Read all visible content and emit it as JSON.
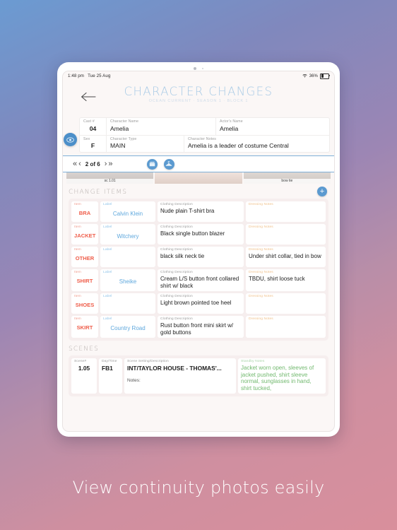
{
  "statusbar": {
    "time": "1:48 pm",
    "date": "Tue 25 Aug",
    "battery": "36%"
  },
  "header": {
    "back_icon": "back-arrow-icon",
    "title": "CHARACTER CHANGES",
    "subtitle": "OCEAN CURRENT · SEASON 1 · BLOCK 1"
  },
  "detail": {
    "eye_icon": "eye-icon",
    "cast_label": "Cast #",
    "cast_value": "04",
    "character_name_label": "Character Name",
    "character_name_value": "Amelia",
    "actor_label": "Actor's Name",
    "actor_value": "Amelia",
    "sex_label": "Sex",
    "sex_value": "F",
    "character_type_label": "Character Type",
    "character_type_value": "MAIN",
    "character_notes_label": "Character Notes",
    "character_notes_value": "Amelia is a leader of costume Central"
  },
  "pager": {
    "first": "«",
    "prev": "‹",
    "next": "›",
    "last": "»",
    "position": "2 of 6",
    "slate_icon": "clapperboard-icon",
    "hanger_icon": "clothes-hanger-icon"
  },
  "photostrip": [
    {
      "caption": "sc 1.01"
    },
    {
      "caption": ""
    },
    {
      "caption": "bow tie"
    }
  ],
  "change_items": {
    "heading": "CHANGE ITEMS",
    "add_label": "+",
    "columns": {
      "item": "Item",
      "label": "Label",
      "description": "Clothing Description",
      "notes": "Dressing Notes"
    },
    "rows": [
      {
        "item": "BRA",
        "label": "Calvin Klein",
        "description": "Nude plain T-shirt bra",
        "notes": ""
      },
      {
        "item": "JACKET",
        "label": "Witchery",
        "description": "Black single button blazer",
        "notes": ""
      },
      {
        "item": "OTHER",
        "label": "",
        "description": "black silk neck tie",
        "notes": "Under shirt collar, tied in bow"
      },
      {
        "item": "SHIRT",
        "label": "Sheike",
        "description": "Cream L/S button front collared shirt w/ black",
        "notes": "TBDU, shirt loose tuck"
      },
      {
        "item": "SHOES",
        "label": "",
        "description": "Light brown pointed toe heel",
        "notes": ""
      },
      {
        "item": "SKIRT",
        "label": "Country Road",
        "description": "Rust button front mini skirt w/ gold buttons",
        "notes": ""
      }
    ]
  },
  "scenes": {
    "heading": "SCENES",
    "columns": {
      "scene": "Scene#",
      "daytime": "Day/Time",
      "setting": "Scene Setting/Description",
      "notes": "Standby Notes"
    },
    "rows": [
      {
        "scene": "1.05",
        "daytime": "FB1",
        "setting": "INT/TAYLOR HOUSE - THOMAS'...",
        "notes_label": "Notes:",
        "notes": "Jacket worn open, sleeves of jacket pushed, shirt sleeve normal, sunglasses in hand, shirt tucked,"
      }
    ]
  },
  "caption": "View continuity photos easily"
}
